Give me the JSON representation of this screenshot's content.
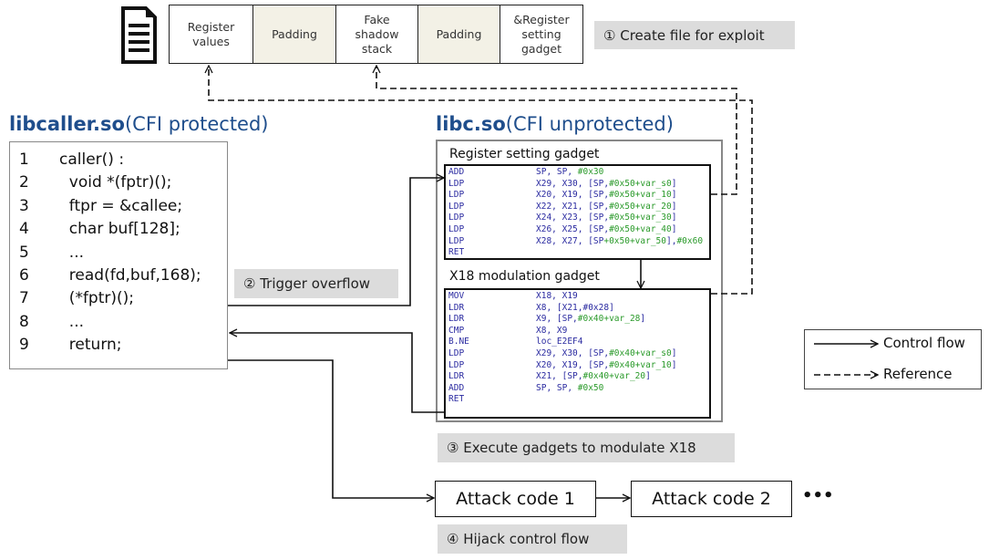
{
  "file": {
    "icon": "document-icon",
    "cells": [
      "Register\nvalues",
      "Padding",
      "Fake\nshadow\nstack",
      "Padding",
      "&Register\nsetting\ngadget"
    ],
    "step": "① Create file for exploit"
  },
  "caller": {
    "title_bold": "libcaller.so",
    "title_rest": "(CFI protected)",
    "lines": [
      {
        "n": "1",
        "code": "caller() :"
      },
      {
        "n": "2",
        "code": "  void *(fptr)();"
      },
      {
        "n": "3",
        "code": "  ftpr = &callee;"
      },
      {
        "n": "4",
        "code": "  char buf[128];"
      },
      {
        "n": "5",
        "code": "  ..."
      },
      {
        "n": "6",
        "code": "  read(fd,buf,168);"
      },
      {
        "n": "7",
        "code": "  (*fptr)();"
      },
      {
        "n": "8",
        "code": "  ..."
      },
      {
        "n": "9",
        "code": "  return;"
      }
    ],
    "step": "② Trigger overflow"
  },
  "libc": {
    "title_bold": "libc.so",
    "title_rest": "(CFI unprotected)",
    "gadget1": {
      "label": "Register setting gadget",
      "lines": [
        {
          "op": "ADD",
          "args": "SP, SP, #0x30"
        },
        {
          "op": "LDP",
          "args": "X29, X30, [SP,#0x50+var_s0]"
        },
        {
          "op": "LDP",
          "args": "X20, X19, [SP,#0x50+var_10]"
        },
        {
          "op": "LDP",
          "args": "X22, X21, [SP,#0x50+var_20]"
        },
        {
          "op": "LDP",
          "args": "X24, X23, [SP,#0x50+var_30]"
        },
        {
          "op": "LDP",
          "args": "X26, X25, [SP,#0x50+var_40]"
        },
        {
          "op": "LDP",
          "args": "X28, X27, [SP+0x50+var_50],#0x60"
        },
        {
          "op": "RET",
          "args": ""
        }
      ]
    },
    "gadget2": {
      "label": "X18 modulation gadget",
      "lines": [
        {
          "op": "MOV",
          "args": "X18, X19"
        },
        {
          "op": "LDR",
          "args": "X8, [X21,#0x28]"
        },
        {
          "op": "LDR",
          "args": "X9, [SP,#0x40+var_28]"
        },
        {
          "op": "CMP",
          "args": "X8, X9"
        },
        {
          "op": "B.NE",
          "args": "loc_E2EF4"
        },
        {
          "op": "LDP",
          "args": "X29, X30, [SP,#0x40+var_s0]"
        },
        {
          "op": "LDP",
          "args": "X20, X19, [SP,#0x40+var_10]"
        },
        {
          "op": "LDR",
          "args": "X21, [SP,#0x40+var_20]"
        },
        {
          "op": "ADD",
          "args": "SP, SP, #0x50"
        },
        {
          "op": "RET",
          "args": ""
        }
      ]
    },
    "step": "③ Execute gadgets to modulate X18"
  },
  "attack": {
    "box1": "Attack code 1",
    "box2": "Attack code 2",
    "more": "•••",
    "step": "④ Hijack control flow"
  },
  "legend": {
    "control_flow": "Control flow",
    "reference": "Reference"
  },
  "colors": {
    "title_blue": "#1f4e8c",
    "asm_blue": "#2a2aa0",
    "asm_green": "#2a9a2a",
    "asm_orange": "#f08a20",
    "padding": "#f3f1e6",
    "step_bg": "#dcdcdc"
  }
}
